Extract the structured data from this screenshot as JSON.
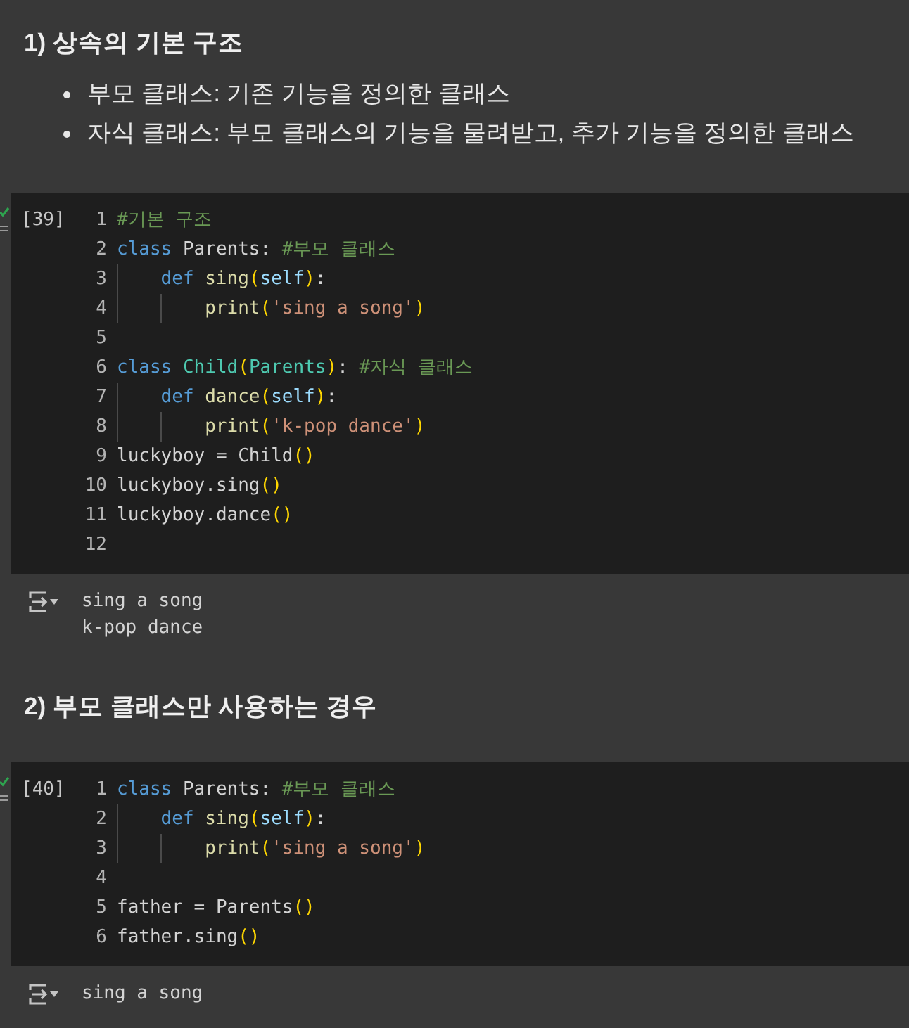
{
  "cells": [
    {
      "kind": "markdown",
      "heading": "1) 상속의 기본 구조",
      "bullets": [
        "부모 클래스: 기존 기능을 정의한 클래스",
        "자식 클래스: 부모 클래스의 기능을 물려받고, 추가 기능을 정의한 클래스"
      ]
    },
    {
      "kind": "code",
      "executed": true,
      "execution_count": "[39]",
      "lines": [
        {
          "number": "1",
          "tokens": [
            {
              "kind": "comment",
              "text": "#기본 구조"
            }
          ]
        },
        {
          "number": "2",
          "tokens": [
            {
              "kind": "keyword",
              "text": "class"
            },
            {
              "kind": "plain",
              "text": " Parents: "
            },
            {
              "kind": "comment",
              "text": "#부모 클래스"
            }
          ],
          "children": [
            {
              "number": "3",
              "tokens": [
                {
                  "kind": "keyword",
                  "text": "def "
                },
                {
                  "kind": "function",
                  "text": "sing"
                },
                {
                  "kind": "bracket",
                  "text": "("
                },
                {
                  "kind": "param",
                  "text": "self"
                },
                {
                  "kind": "bracket",
                  "text": ")"
                },
                {
                  "kind": "plain",
                  "text": ":"
                }
              ],
              "children": [
                {
                  "number": "4",
                  "tokens": [
                    {
                      "kind": "function",
                      "text": "print"
                    },
                    {
                      "kind": "bracket",
                      "text": "("
                    },
                    {
                      "kind": "string",
                      "text": "'sing a song'"
                    },
                    {
                      "kind": "bracket",
                      "text": ")"
                    }
                  ]
                }
              ]
            }
          ]
        },
        {
          "number": "5"
        },
        {
          "number": "6",
          "tokens": [
            {
              "kind": "keyword",
              "text": "class "
            },
            {
              "kind": "classname",
              "text": "Child"
            },
            {
              "kind": "bracket",
              "text": "("
            },
            {
              "kind": "classname",
              "text": "Parents"
            },
            {
              "kind": "bracket",
              "text": ")"
            },
            {
              "kind": "plain",
              "text": ": "
            },
            {
              "kind": "comment",
              "text": "#자식 클래스"
            }
          ],
          "children": [
            {
              "number": "7",
              "tokens": [
                {
                  "kind": "keyword",
                  "text": "def "
                },
                {
                  "kind": "function",
                  "text": "dance"
                },
                {
                  "kind": "bracket",
                  "text": "("
                },
                {
                  "kind": "param",
                  "text": "self"
                },
                {
                  "kind": "bracket",
                  "text": ")"
                },
                {
                  "kind": "plain",
                  "text": ":"
                }
              ],
              "children": [
                {
                  "number": "8",
                  "tokens": [
                    {
                      "kind": "function",
                      "text": "print"
                    },
                    {
                      "kind": "bracket",
                      "text": "("
                    },
                    {
                      "kind": "string",
                      "text": "'k-pop dance'"
                    },
                    {
                      "kind": "bracket",
                      "text": ")"
                    }
                  ]
                }
              ]
            }
          ]
        },
        {
          "number": "9",
          "tokens": [
            {
              "kind": "plain",
              "text": "luckyboy = Child"
            },
            {
              "kind": "bracket",
              "text": "()"
            }
          ]
        },
        {
          "number": "10",
          "tokens": [
            {
              "kind": "plain",
              "text": "luckyboy.sing"
            },
            {
              "kind": "bracket",
              "text": "()"
            }
          ]
        },
        {
          "number": "11",
          "tokens": [
            {
              "kind": "plain",
              "text": "luckyboy.dance"
            },
            {
              "kind": "bracket",
              "text": "()"
            }
          ]
        },
        {
          "number": "12"
        }
      ],
      "output": [
        "sing a song",
        "k-pop dance"
      ]
    },
    {
      "kind": "markdown",
      "heading": "2) 부모 클래스만 사용하는 경우"
    },
    {
      "kind": "code",
      "executed": true,
      "execution_count": "[40]",
      "lines": [
        {
          "number": "1",
          "tokens": [
            {
              "kind": "keyword",
              "text": "class"
            },
            {
              "kind": "plain",
              "text": " Parents: "
            },
            {
              "kind": "comment",
              "text": "#부모 클래스"
            }
          ],
          "children": [
            {
              "number": "2",
              "tokens": [
                {
                  "kind": "keyword",
                  "text": "def "
                },
                {
                  "kind": "function",
                  "text": "sing"
                },
                {
                  "kind": "bracket",
                  "text": "("
                },
                {
                  "kind": "param",
                  "text": "self"
                },
                {
                  "kind": "bracket",
                  "text": ")"
                },
                {
                  "kind": "plain",
                  "text": ":"
                }
              ],
              "children": [
                {
                  "number": "3",
                  "tokens": [
                    {
                      "kind": "function",
                      "text": "print"
                    },
                    {
                      "kind": "bracket",
                      "text": "("
                    },
                    {
                      "kind": "string",
                      "text": "'sing a song'"
                    },
                    {
                      "kind": "bracket",
                      "text": ")"
                    }
                  ]
                }
              ]
            }
          ]
        },
        {
          "number": "4"
        },
        {
          "number": "5",
          "tokens": [
            {
              "kind": "plain",
              "text": "father = Parents"
            },
            {
              "kind": "bracket",
              "text": "()"
            }
          ]
        },
        {
          "number": "6",
          "tokens": [
            {
              "kind": "plain",
              "text": "father.sing"
            },
            {
              "kind": "bracket",
              "text": "()"
            }
          ]
        }
      ],
      "output": [
        "sing a song"
      ]
    }
  ]
}
